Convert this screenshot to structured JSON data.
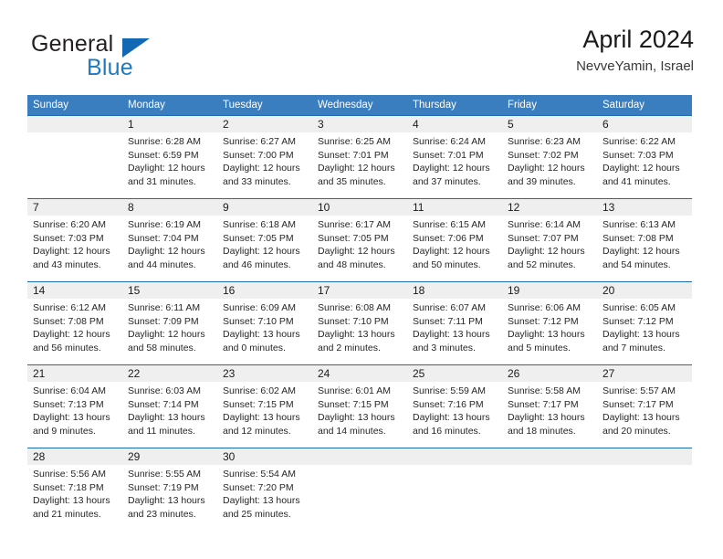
{
  "brand": {
    "word_one": "General",
    "word_two": "Blue",
    "accent_color": "#1268b3",
    "text_color": "#231f20"
  },
  "header": {
    "title": "April 2024",
    "subtitle": "NevveYamin, Israel",
    "header_bg": "#3a7ebf",
    "row_divider": "#1f6bb0",
    "date_band_bg": "#efefef"
  },
  "weekdays": [
    "Sunday",
    "Monday",
    "Tuesday",
    "Wednesday",
    "Thursday",
    "Friday",
    "Saturday"
  ],
  "labels": {
    "sunrise": "Sunrise:",
    "sunset": "Sunset:",
    "daylight": "Daylight:"
  },
  "weeks": [
    [
      {
        "day": "",
        "sunrise": "",
        "sunset": "",
        "daylight_1": "",
        "daylight_2": ""
      },
      {
        "day": "1",
        "sunrise": "Sunrise: 6:28 AM",
        "sunset": "Sunset: 6:59 PM",
        "daylight_1": "Daylight: 12 hours",
        "daylight_2": "and 31 minutes."
      },
      {
        "day": "2",
        "sunrise": "Sunrise: 6:27 AM",
        "sunset": "Sunset: 7:00 PM",
        "daylight_1": "Daylight: 12 hours",
        "daylight_2": "and 33 minutes."
      },
      {
        "day": "3",
        "sunrise": "Sunrise: 6:25 AM",
        "sunset": "Sunset: 7:01 PM",
        "daylight_1": "Daylight: 12 hours",
        "daylight_2": "and 35 minutes."
      },
      {
        "day": "4",
        "sunrise": "Sunrise: 6:24 AM",
        "sunset": "Sunset: 7:01 PM",
        "daylight_1": "Daylight: 12 hours",
        "daylight_2": "and 37 minutes."
      },
      {
        "day": "5",
        "sunrise": "Sunrise: 6:23 AM",
        "sunset": "Sunset: 7:02 PM",
        "daylight_1": "Daylight: 12 hours",
        "daylight_2": "and 39 minutes."
      },
      {
        "day": "6",
        "sunrise": "Sunrise: 6:22 AM",
        "sunset": "Sunset: 7:03 PM",
        "daylight_1": "Daylight: 12 hours",
        "daylight_2": "and 41 minutes."
      }
    ],
    [
      {
        "day": "7",
        "sunrise": "Sunrise: 6:20 AM",
        "sunset": "Sunset: 7:03 PM",
        "daylight_1": "Daylight: 12 hours",
        "daylight_2": "and 43 minutes."
      },
      {
        "day": "8",
        "sunrise": "Sunrise: 6:19 AM",
        "sunset": "Sunset: 7:04 PM",
        "daylight_1": "Daylight: 12 hours",
        "daylight_2": "and 44 minutes."
      },
      {
        "day": "9",
        "sunrise": "Sunrise: 6:18 AM",
        "sunset": "Sunset: 7:05 PM",
        "daylight_1": "Daylight: 12 hours",
        "daylight_2": "and 46 minutes."
      },
      {
        "day": "10",
        "sunrise": "Sunrise: 6:17 AM",
        "sunset": "Sunset: 7:05 PM",
        "daylight_1": "Daylight: 12 hours",
        "daylight_2": "and 48 minutes."
      },
      {
        "day": "11",
        "sunrise": "Sunrise: 6:15 AM",
        "sunset": "Sunset: 7:06 PM",
        "daylight_1": "Daylight: 12 hours",
        "daylight_2": "and 50 minutes."
      },
      {
        "day": "12",
        "sunrise": "Sunrise: 6:14 AM",
        "sunset": "Sunset: 7:07 PM",
        "daylight_1": "Daylight: 12 hours",
        "daylight_2": "and 52 minutes."
      },
      {
        "day": "13",
        "sunrise": "Sunrise: 6:13 AM",
        "sunset": "Sunset: 7:08 PM",
        "daylight_1": "Daylight: 12 hours",
        "daylight_2": "and 54 minutes."
      }
    ],
    [
      {
        "day": "14",
        "sunrise": "Sunrise: 6:12 AM",
        "sunset": "Sunset: 7:08 PM",
        "daylight_1": "Daylight: 12 hours",
        "daylight_2": "and 56 minutes."
      },
      {
        "day": "15",
        "sunrise": "Sunrise: 6:11 AM",
        "sunset": "Sunset: 7:09 PM",
        "daylight_1": "Daylight: 12 hours",
        "daylight_2": "and 58 minutes."
      },
      {
        "day": "16",
        "sunrise": "Sunrise: 6:09 AM",
        "sunset": "Sunset: 7:10 PM",
        "daylight_1": "Daylight: 13 hours",
        "daylight_2": "and 0 minutes."
      },
      {
        "day": "17",
        "sunrise": "Sunrise: 6:08 AM",
        "sunset": "Sunset: 7:10 PM",
        "daylight_1": "Daylight: 13 hours",
        "daylight_2": "and 2 minutes."
      },
      {
        "day": "18",
        "sunrise": "Sunrise: 6:07 AM",
        "sunset": "Sunset: 7:11 PM",
        "daylight_1": "Daylight: 13 hours",
        "daylight_2": "and 3 minutes."
      },
      {
        "day": "19",
        "sunrise": "Sunrise: 6:06 AM",
        "sunset": "Sunset: 7:12 PM",
        "daylight_1": "Daylight: 13 hours",
        "daylight_2": "and 5 minutes."
      },
      {
        "day": "20",
        "sunrise": "Sunrise: 6:05 AM",
        "sunset": "Sunset: 7:12 PM",
        "daylight_1": "Daylight: 13 hours",
        "daylight_2": "and 7 minutes."
      }
    ],
    [
      {
        "day": "21",
        "sunrise": "Sunrise: 6:04 AM",
        "sunset": "Sunset: 7:13 PM",
        "daylight_1": "Daylight: 13 hours",
        "daylight_2": "and 9 minutes."
      },
      {
        "day": "22",
        "sunrise": "Sunrise: 6:03 AM",
        "sunset": "Sunset: 7:14 PM",
        "daylight_1": "Daylight: 13 hours",
        "daylight_2": "and 11 minutes."
      },
      {
        "day": "23",
        "sunrise": "Sunrise: 6:02 AM",
        "sunset": "Sunset: 7:15 PM",
        "daylight_1": "Daylight: 13 hours",
        "daylight_2": "and 12 minutes."
      },
      {
        "day": "24",
        "sunrise": "Sunrise: 6:01 AM",
        "sunset": "Sunset: 7:15 PM",
        "daylight_1": "Daylight: 13 hours",
        "daylight_2": "and 14 minutes."
      },
      {
        "day": "25",
        "sunrise": "Sunrise: 5:59 AM",
        "sunset": "Sunset: 7:16 PM",
        "daylight_1": "Daylight: 13 hours",
        "daylight_2": "and 16 minutes."
      },
      {
        "day": "26",
        "sunrise": "Sunrise: 5:58 AM",
        "sunset": "Sunset: 7:17 PM",
        "daylight_1": "Daylight: 13 hours",
        "daylight_2": "and 18 minutes."
      },
      {
        "day": "27",
        "sunrise": "Sunrise: 5:57 AM",
        "sunset": "Sunset: 7:17 PM",
        "daylight_1": "Daylight: 13 hours",
        "daylight_2": "and 20 minutes."
      }
    ],
    [
      {
        "day": "28",
        "sunrise": "Sunrise: 5:56 AM",
        "sunset": "Sunset: 7:18 PM",
        "daylight_1": "Daylight: 13 hours",
        "daylight_2": "and 21 minutes."
      },
      {
        "day": "29",
        "sunrise": "Sunrise: 5:55 AM",
        "sunset": "Sunset: 7:19 PM",
        "daylight_1": "Daylight: 13 hours",
        "daylight_2": "and 23 minutes."
      },
      {
        "day": "30",
        "sunrise": "Sunrise: 5:54 AM",
        "sunset": "Sunset: 7:20 PM",
        "daylight_1": "Daylight: 13 hours",
        "daylight_2": "and 25 minutes."
      },
      {
        "day": "",
        "sunrise": "",
        "sunset": "",
        "daylight_1": "",
        "daylight_2": ""
      },
      {
        "day": "",
        "sunrise": "",
        "sunset": "",
        "daylight_1": "",
        "daylight_2": ""
      },
      {
        "day": "",
        "sunrise": "",
        "sunset": "",
        "daylight_1": "",
        "daylight_2": ""
      },
      {
        "day": "",
        "sunrise": "",
        "sunset": "",
        "daylight_1": "",
        "daylight_2": ""
      }
    ]
  ]
}
